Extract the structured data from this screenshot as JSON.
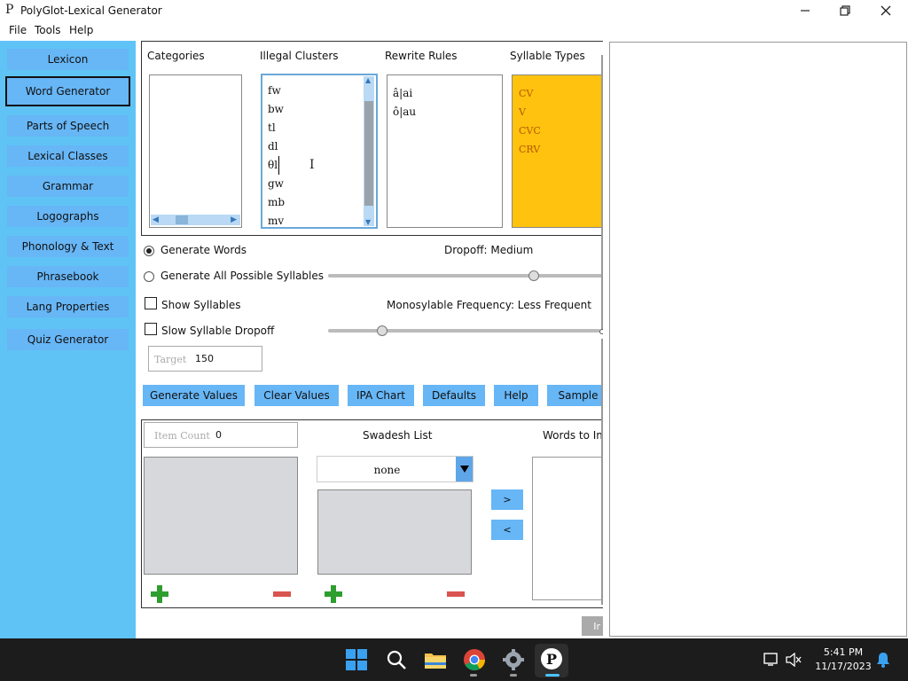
{
  "window": {
    "title": "PolyGlot-Lexical Generator",
    "icon_glyph": "P"
  },
  "menu": [
    "File",
    "Tools",
    "Help"
  ],
  "sidebar": {
    "items": [
      {
        "label": "Lexicon"
      },
      {
        "label": "Word Generator"
      },
      {
        "label": "Parts of Speech"
      },
      {
        "label": "Lexical Classes"
      },
      {
        "label": "Grammar"
      },
      {
        "label": "Logographs"
      },
      {
        "label": "Phonology & Text"
      },
      {
        "label": "Phrasebook"
      },
      {
        "label": "Lang Properties"
      },
      {
        "label": "Quiz Generator"
      }
    ],
    "selected": "Word Generator"
  },
  "panels": {
    "categories": {
      "label": "Categories"
    },
    "illegal": {
      "label": "Illegal Clusters",
      "items": [
        "fw",
        "bw",
        "tl",
        "dl",
        "θl",
        "gw",
        "mb",
        "mv"
      ]
    },
    "rewrite": {
      "label": "Rewrite Rules",
      "items": [
        "â|ai",
        "ô|au"
      ]
    },
    "syllable": {
      "label": "Syllable Types",
      "items": [
        "CV",
        "V",
        "CVC",
        "CRV"
      ]
    }
  },
  "options": {
    "generate_words": "Generate Words",
    "generate_syllables": "Generate All Possible Syllables",
    "show_syllables": "Show Syllables",
    "slow_dropoff": "Slow Syllable Dropoff",
    "dropoff_label": "Dropoff: Medium",
    "dropoff_level": 0.8,
    "mono_label": "Monosylable Frequency: Less Frequent",
    "mono_level": 0.2,
    "target_placeholder": "Target",
    "target_value": "150"
  },
  "buttons": [
    "Generate Values",
    "Clear Values",
    "IPA Chart",
    "Defaults",
    "Help",
    "Sample"
  ],
  "lower": {
    "item_count_placeholder": "Item Count",
    "item_count_value": "0",
    "swadesh_label": "Swadesh List",
    "swadesh_selected": "none",
    "words_label": "Words to Im",
    "move_right": ">",
    "move_left": "<",
    "import_label": "Ir"
  },
  "taskbar": {
    "time": "5:41 PM",
    "date": "11/17/2023"
  },
  "colors": {
    "sidebar": "#5fc3f5",
    "button": "#67b6f6",
    "syllable_bg": "#ffc20e",
    "syllable_text": "#b35a00",
    "plus": "#2e9e2e",
    "minus": "#d9534f"
  }
}
